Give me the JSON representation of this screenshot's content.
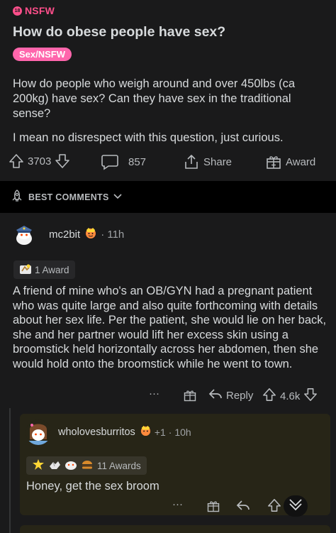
{
  "post": {
    "nsfw_label": "NSFW",
    "nsfw_badge": "18",
    "title": "How do obese people have sex?",
    "flair": "Sex/NSFW",
    "body_paragraphs": [
      "How do people who weigh around and over 450lbs (ca 200kg) have sex? Can they have sex in the traditional sense?",
      "I mean no disrespect with this question, just curious."
    ],
    "votes": "3703",
    "comments": "857",
    "share_label": "Share",
    "award_label": "Award"
  },
  "sort": {
    "label": "BEST COMMENTS"
  },
  "comment": {
    "username": "mc2bit",
    "time": "· 11h",
    "award_chip": "1 Award",
    "body": "A friend of mine who's an OB/GYN had a pregnant patient who was quite large and also quite forthcoming with details about her sex life. Per the patient, she would lie on her back, she and her partner would lift her excess skin using a broomstick held horizontally across her abdomen, then she would hold onto the broomstick while he went to town.",
    "more": "···",
    "reply_label": "Reply",
    "votes": "4.6k"
  },
  "reply": {
    "username": "wholovesburritos",
    "plus": "+1",
    "time": "· 10h",
    "awards_label": "11 Awards",
    "body": "Honey, get the sex broom",
    "more": "···"
  },
  "colors": {
    "background": "#000000",
    "card": "#1a1a1b",
    "nsfw": "#ff4f8b",
    "flair": "#ff66ac",
    "highlight": "#272517"
  }
}
